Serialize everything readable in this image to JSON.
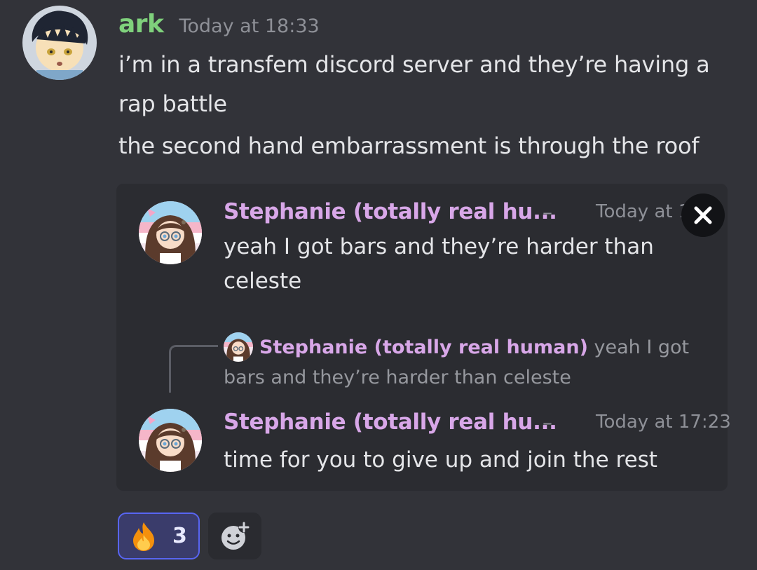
{
  "message": {
    "author": "ark",
    "timestamp": "Today at 18:33",
    "lines": [
      "i’m in a transfem discord server and they’re having a rap battle",
      "the second hand embarrassment is through the roof"
    ],
    "avatar_icon": "anime-boy-avatar"
  },
  "embed": {
    "first": {
      "author": "Stephanie (totally real hu...",
      "separator": "–",
      "timestamp": "Today at 17",
      "text": "yeah I got bars and they’re harder than celeste"
    },
    "reply": {
      "author": "Stephanie (totally real human)",
      "text": "yeah I got bars and they’re harder than celeste"
    },
    "second": {
      "author": "Stephanie (totally real hu...",
      "separator": "–",
      "timestamp": "Today at 17:23",
      "text": "time for you to give up and join the rest"
    },
    "avatar_icon": "anime-girl-avatar",
    "close_icon": "close-icon"
  },
  "reactions": [
    {
      "emoji": "🔥",
      "count": "3",
      "active": true
    }
  ],
  "add_reaction_icon": "add-reaction-icon",
  "colors": {
    "background": "#323339",
    "author_green": "#7fd17c",
    "author_pink": "#d8a7e8",
    "accent": "#5865f2"
  }
}
